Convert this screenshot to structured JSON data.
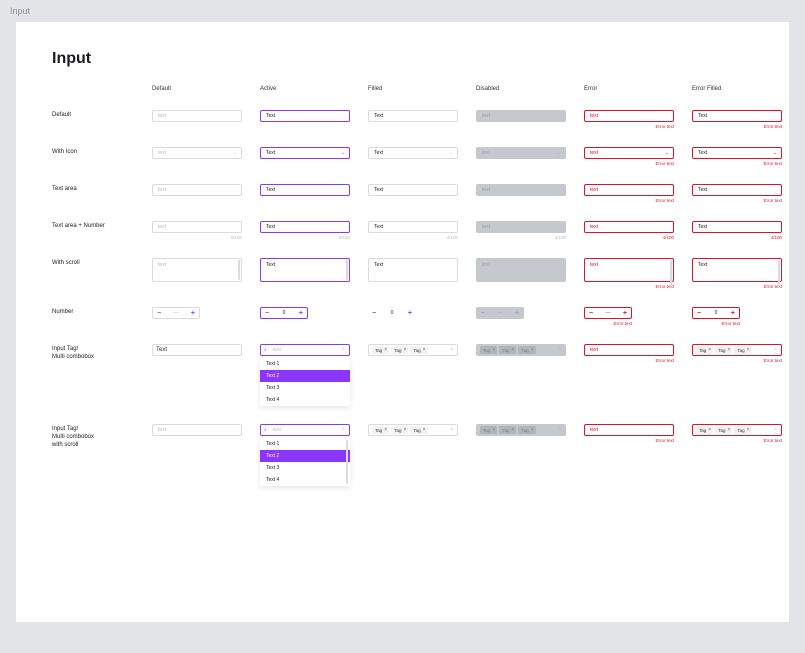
{
  "pageLabel": "Input",
  "pageTitle": "Input",
  "columns": [
    "Default",
    "Active",
    "Filled",
    "Disabled",
    "Error",
    "Error Filled"
  ],
  "rows": {
    "default": "Default",
    "withIcon": "With Icon",
    "textArea": "Text area",
    "textAreaNumber": "Text area + Number",
    "withScroll": "With scroll",
    "number": "Number",
    "inputTag": "Input Tag/\nMulti combobox",
    "inputTagScroll": "Input Tag/\nMulti combobox\nwith scroll"
  },
  "placeholder": "text",
  "valueText": "Text",
  "errorLabel": "Error text",
  "counter": {
    "empty": "0/100",
    "filled": "4/100"
  },
  "number": {
    "default": "—",
    "value": "0"
  },
  "tagText": "Tag",
  "dropdownItems": [
    "Text 1",
    "Text 2",
    "Text 3",
    "Text 4"
  ],
  "dropdownSelectedIndex": 1
}
